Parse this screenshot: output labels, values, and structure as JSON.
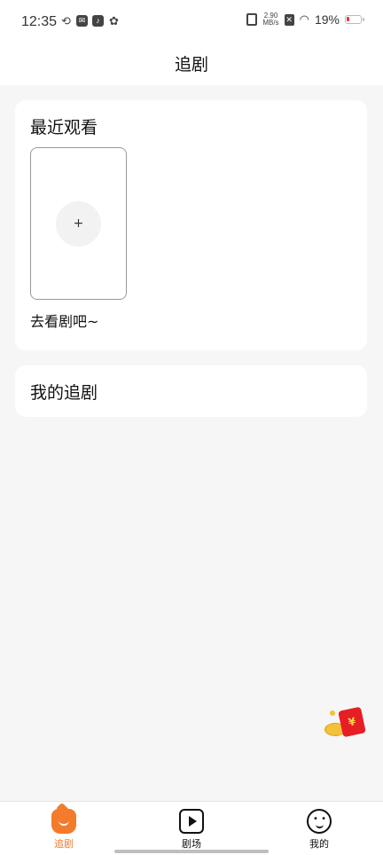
{
  "status_bar": {
    "time": "12:35",
    "net_speed_value": "2.90",
    "net_speed_unit": "MB/s",
    "battery_percent": "19%"
  },
  "header": {
    "title": "追剧"
  },
  "recent": {
    "title": "最近观看",
    "add_symbol": "+",
    "empty_hint": "去看剧吧~"
  },
  "my_follow": {
    "title": "我的追剧"
  },
  "tabbar": {
    "tabs": [
      {
        "label": "追剧",
        "icon": "home-icon",
        "active": true
      },
      {
        "label": "剧场",
        "icon": "play-icon",
        "active": false
      },
      {
        "label": "我的",
        "icon": "profile-face-icon",
        "active": false
      }
    ]
  },
  "colors": {
    "accent": "#f07a2c",
    "background": "#f6f6f6",
    "card": "#ffffff"
  }
}
